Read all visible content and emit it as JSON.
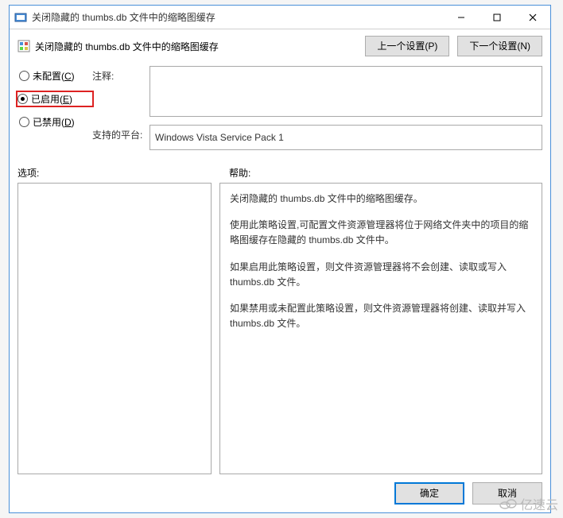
{
  "titlebar": {
    "title": "关闭隐藏的 thumbs.db 文件中的缩略图缓存"
  },
  "header": {
    "title": "关闭隐藏的 thumbs.db 文件中的缩略图缓存",
    "prev_label": "上一个设置(P)",
    "next_label": "下一个设置(N)"
  },
  "radios": {
    "not_configured": "未配置(C)",
    "not_configured_hotkey": "C",
    "enabled": "已启用(E)",
    "enabled_hotkey": "E",
    "disabled": "已禁用(D)",
    "disabled_hotkey": "D",
    "selected": "enabled"
  },
  "fields": {
    "comment_label": "注释:",
    "comment_value": "",
    "platform_label": "支持的平台:",
    "platform_value": "Windows Vista Service Pack 1"
  },
  "sections": {
    "options_label": "选项:",
    "help_label": "帮助:"
  },
  "help": {
    "p1": "关闭隐藏的 thumbs.db 文件中的缩略图缓存。",
    "p2": "使用此策略设置,可配置文件资源管理器将位于网络文件夹中的项目的缩略图缓存在隐藏的 thumbs.db 文件中。",
    "p3": "如果启用此策略设置，则文件资源管理器将不会创建、读取或写入 thumbs.db 文件。",
    "p4": "如果禁用或未配置此策略设置，则文件资源管理器将创建、读取并写入 thumbs.db 文件。"
  },
  "footer": {
    "ok_label": "确定",
    "cancel_label": "取消"
  },
  "watermark": "亿速云"
}
